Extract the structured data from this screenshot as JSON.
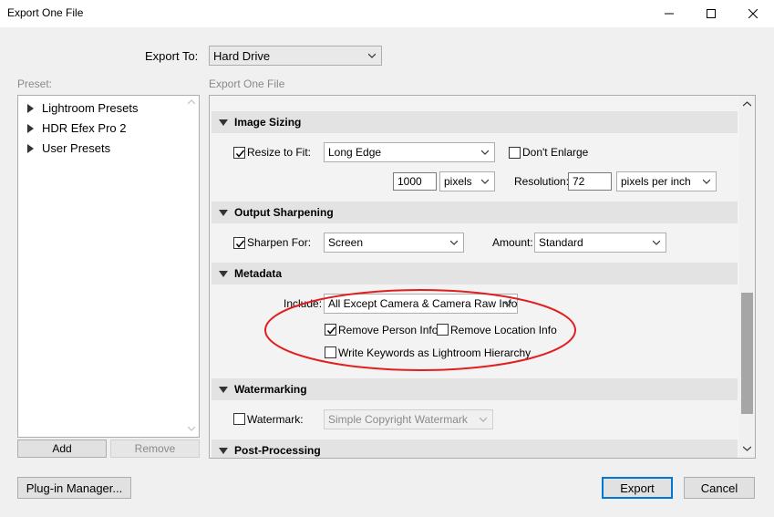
{
  "window": {
    "title": "Export One File"
  },
  "export_to": {
    "label": "Export To:",
    "value": "Hard Drive"
  },
  "preset": {
    "label": "Preset:",
    "items": [
      "Lightroom Presets",
      "HDR Efex Pro 2",
      "User Presets"
    ],
    "add_label": "Add",
    "remove_label": "Remove"
  },
  "panel": {
    "label": "Export One File"
  },
  "image_sizing": {
    "header": "Image Sizing",
    "resize_label": "Resize to Fit:",
    "resize_checked": true,
    "resize_mode": "Long Edge",
    "dont_enlarge_label": "Don't Enlarge",
    "dont_enlarge_checked": false,
    "size_value": "1000",
    "size_unit": "pixels",
    "resolution_label": "Resolution:",
    "resolution_value": "72",
    "resolution_unit": "pixels per inch"
  },
  "output_sharpening": {
    "header": "Output Sharpening",
    "sharpen_label": "Sharpen For:",
    "sharpen_checked": true,
    "sharpen_for": "Screen",
    "amount_label": "Amount:",
    "amount": "Standard"
  },
  "metadata": {
    "header": "Metadata",
    "include_label": "Include:",
    "include_value": "All Except Camera & Camera Raw Info",
    "remove_person_label": "Remove Person Info",
    "remove_person_checked": true,
    "remove_location_label": "Remove Location Info",
    "remove_location_checked": false,
    "keywords_label": "Write Keywords as Lightroom Hierarchy",
    "keywords_checked": false,
    "highlight_color": "#e02020"
  },
  "watermarking": {
    "header": "Watermarking",
    "watermark_label": "Watermark:",
    "watermark_checked": false,
    "watermark_value": "Simple Copyright Watermark"
  },
  "post_processing": {
    "header": "Post-Processing"
  },
  "footer": {
    "plugin_label": "Plug-in Manager...",
    "export_label": "Export",
    "cancel_label": "Cancel"
  },
  "colors": {
    "accent": "#0078d7"
  }
}
